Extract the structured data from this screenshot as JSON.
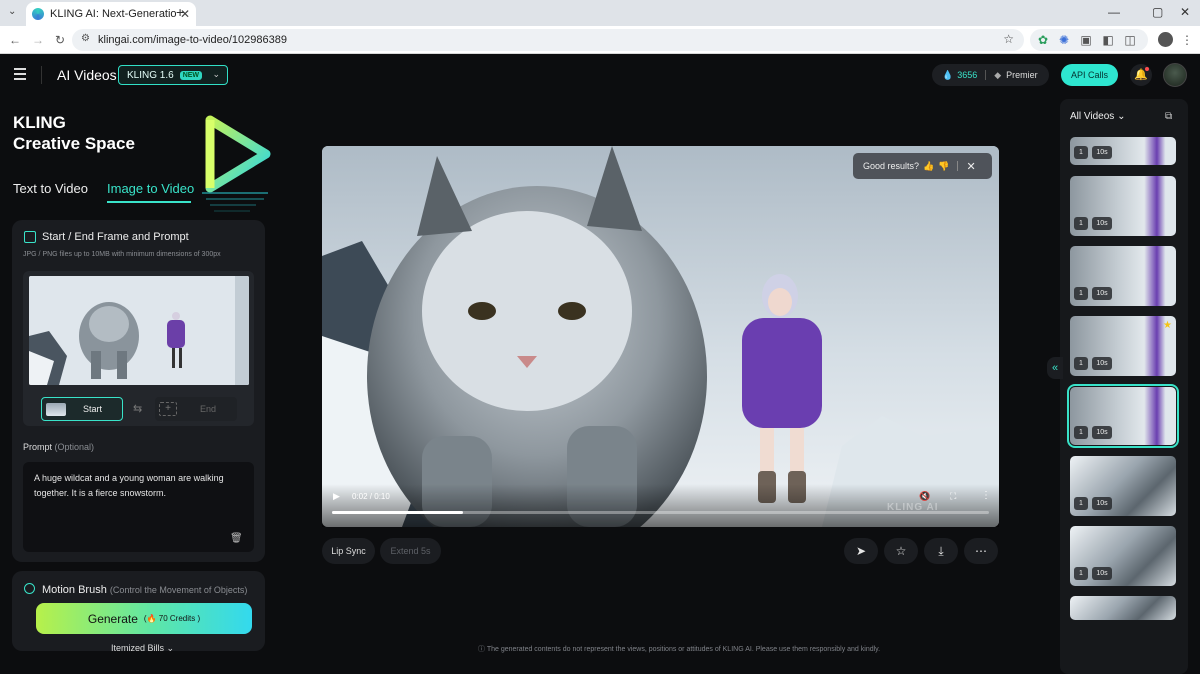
{
  "browser": {
    "tab_title": "KLING AI: Next-Generation AI C",
    "url": "klingai.com/image-to-video/102986389"
  },
  "header": {
    "app_title": "AI Videos",
    "model": "KLING 1.6",
    "model_badge": "NEW",
    "credits": "3656",
    "plan": "Premier",
    "api_label": "API Calls"
  },
  "brand": {
    "line1": "KLING",
    "line2": "Creative Space"
  },
  "tabs": [
    {
      "label": "Text to Video",
      "active": false
    },
    {
      "label": "Image to Video",
      "active": true
    }
  ],
  "frame_card": {
    "title": "Start / End Frame and Prompt",
    "hint": "JPG / PNG files up to 10MB with minimum dimensions of 300px",
    "start_label": "Start",
    "end_label": "End"
  },
  "prompt": {
    "label": "Prompt",
    "optional": "(Optional)",
    "text": "A huge wildcat and a young woman are walking together. It is a fierce snowstorm."
  },
  "motion": {
    "title": "Motion Brush",
    "subtitle": "(Control the Movement of Objects)"
  },
  "generate": {
    "label": "Generate",
    "credits": "70 Credits"
  },
  "itemized_label": "Itemized Bills",
  "player": {
    "feedback": "Good results?",
    "time": "0:02 / 0:10",
    "progress": 0.2,
    "watermark": "KLING AI"
  },
  "actions": {
    "lip_sync": "Lip Sync",
    "extend": "Extend 5s"
  },
  "disclaimer": "The generated contents do not represent the views, positions or attitudes of KLING AI. Please use them responsibly and kindly.",
  "history": {
    "title": "All Videos",
    "items": [
      {
        "count": "1",
        "duration": "10s",
        "starred": false,
        "selected": false,
        "style": "cat"
      },
      {
        "count": "1",
        "duration": "10s",
        "starred": false,
        "selected": false,
        "style": "cat"
      },
      {
        "count": "1",
        "duration": "10s",
        "starred": false,
        "selected": false,
        "style": "cat"
      },
      {
        "count": "1",
        "duration": "10s",
        "starred": true,
        "selected": false,
        "style": "cat"
      },
      {
        "count": "1",
        "duration": "10s",
        "starred": false,
        "selected": true,
        "style": "cat"
      },
      {
        "count": "1",
        "duration": "10s",
        "starred": false,
        "selected": false,
        "style": "snow"
      },
      {
        "count": "1",
        "duration": "10s",
        "starred": false,
        "selected": false,
        "style": "snow"
      },
      {
        "count": "",
        "duration": "",
        "starred": false,
        "selected": false,
        "style": "snow"
      }
    ]
  },
  "colors": {
    "accent": "#39e3c9",
    "background": "#0c0d0f",
    "card": "#1a1c20"
  }
}
